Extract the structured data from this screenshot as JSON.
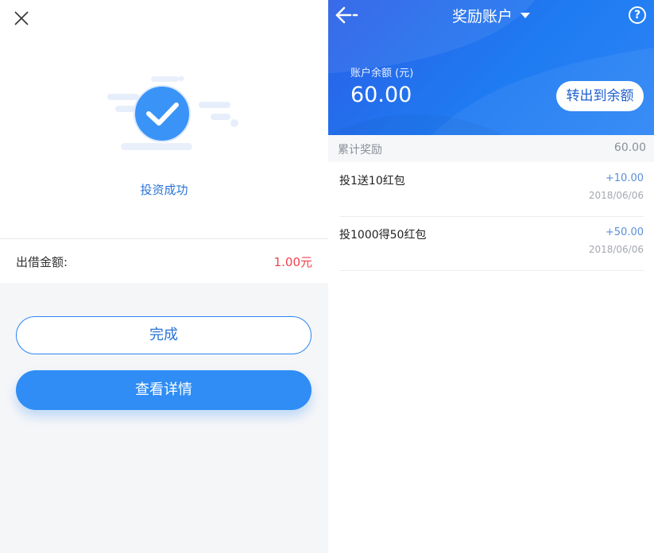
{
  "success_screen": {
    "status_text": "投资成功",
    "amount_label": "出借金额:",
    "amount_value": "1.00元",
    "done_button": "完成",
    "detail_button": "查看详情"
  },
  "reward_account": {
    "title": "奖励账户",
    "help_symbol": "?",
    "balance_label": "账户余额 (元)",
    "balance_value": "60.00",
    "transfer_button": "转出到余额",
    "cumulative_label": "累计奖励",
    "cumulative_value": "60.00",
    "items": [
      {
        "title": "投1送10红包",
        "amount": "+10.00",
        "date": "2018/06/06"
      },
      {
        "title": "投1000得50红包",
        "amount": "+50.00",
        "date": "2018/06/06"
      }
    ]
  },
  "icons": [
    "close-icon",
    "success-check-icon",
    "back-arrow-icon",
    "dropdown-caret-icon",
    "help-icon"
  ],
  "colors": {
    "accent_blue": "#2f8df5",
    "link_blue": "#2a73d6",
    "amount_red": "#f2414b",
    "header_gradient_start": "#2a5fe6",
    "header_gradient_end": "#2e86f6"
  }
}
